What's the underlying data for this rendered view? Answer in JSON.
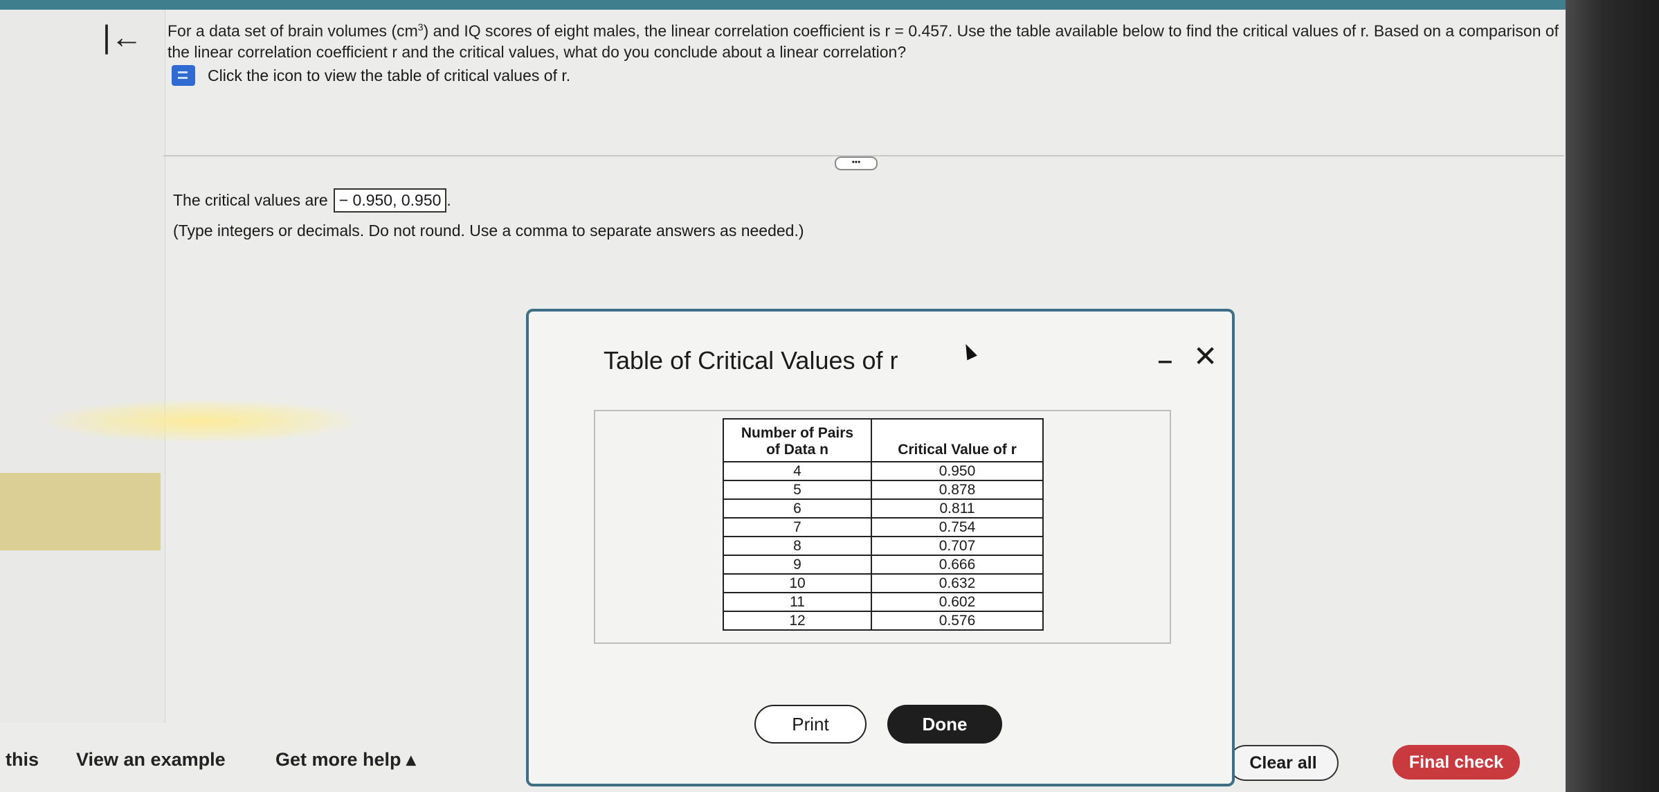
{
  "question": {
    "text_before_sup": "For a data set of brain volumes (cm",
    "sup": "3",
    "text_after_sup": ") and IQ scores of eight males, the linear correlation coefficient is r = 0.457. Use the table available below to find the critical values of r. Based on a comparison of the linear correlation coefficient r and the critical values, what do you conclude about a linear correlation?",
    "hint": "Click the icon to view the table of critical values of r."
  },
  "answer": {
    "prefix": "The critical values are",
    "value": "− 0.950, 0.950",
    "suffix": ".",
    "instruction": "(Type integers or decimals. Do not round. Use a comma to separate answers as needed.)"
  },
  "more_label": "•••",
  "back_icon_glyph": "|←",
  "modal": {
    "title": "Table of Critical Values of r",
    "minimize_glyph": "‒",
    "close_glyph": "✕",
    "table": {
      "headers": [
        "Number of Pairs of Data n",
        "Critical Value of r"
      ],
      "header_line1": "Number of Pairs",
      "header_line2": "of Data n",
      "rows": [
        [
          "4",
          "0.950"
        ],
        [
          "5",
          "0.878"
        ],
        [
          "6",
          "0.811"
        ],
        [
          "7",
          "0.754"
        ],
        [
          "8",
          "0.707"
        ],
        [
          "9",
          "0.666"
        ],
        [
          "10",
          "0.632"
        ],
        [
          "11",
          "0.602"
        ],
        [
          "12",
          "0.576"
        ]
      ]
    },
    "print_label": "Print",
    "done_label": "Done"
  },
  "bottom": {
    "partial_label": "this",
    "view_example": "View an example",
    "get_more_help": "Get more help ▴",
    "clear_all": "Clear all",
    "final_check": "Final check"
  },
  "colors": {
    "accent": "#3e6f85",
    "final_check": "#c93a3f",
    "done": "#1e1e1e"
  }
}
